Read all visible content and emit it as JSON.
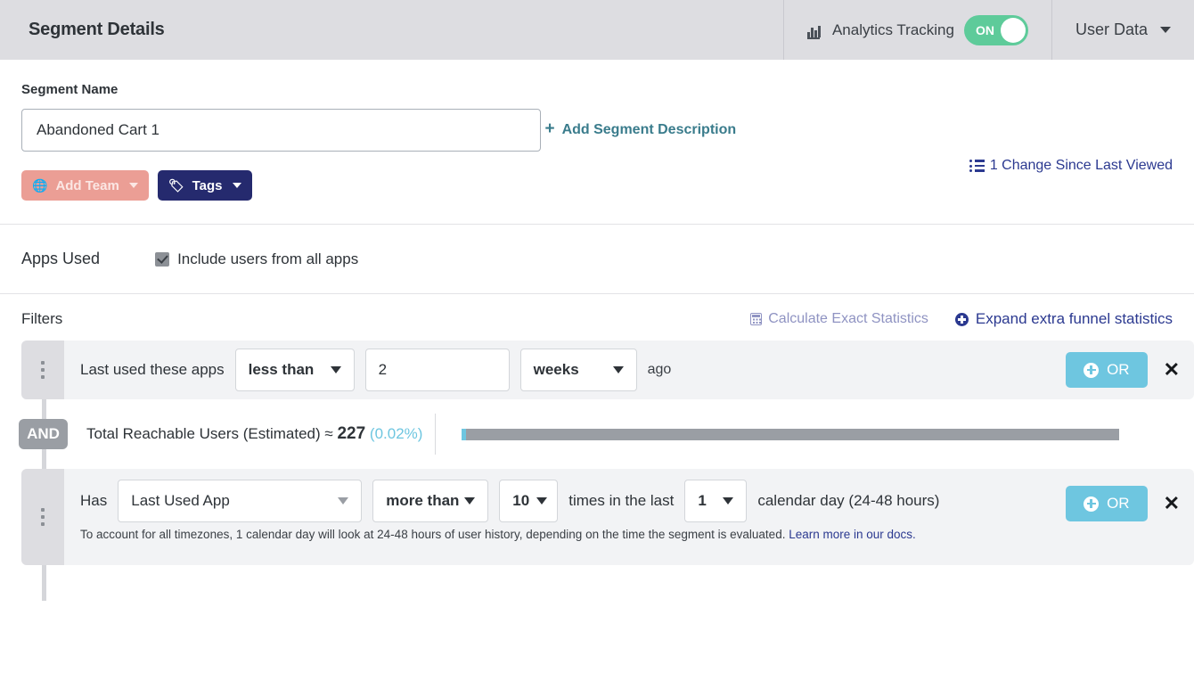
{
  "header": {
    "title": "Segment Details",
    "analytics": {
      "label": "Analytics Tracking",
      "icon": "bar-chart-icon",
      "toggle_state": "ON",
      "toggle_color": "#5ecb9a"
    },
    "user_menu": {
      "label": "User Data",
      "icon": "chevron-down-icon"
    }
  },
  "segment": {
    "name_label": "Segment Name",
    "name_value": "Abandoned Cart 1",
    "name_placeholder": "Segment Name",
    "changes_link": "1 Change Since Last Viewed",
    "changes_icon": "list-icon",
    "add_description": "Add Segment Description",
    "add_description_icon": "plus-icon",
    "buttons": [
      {
        "label": "Add Team",
        "icon": "globe-icon",
        "color": "#eb9e95",
        "text_color": "#fbe7e4",
        "disabled": true
      },
      {
        "label": "Tags",
        "icon": "tag-icon",
        "color": "#252a6e",
        "text_color": "#ffffff",
        "disabled": false
      }
    ]
  },
  "apps_used": {
    "label": "Apps Used",
    "checkbox_label": "Include users from all apps",
    "checked": true
  },
  "filters": {
    "title": "Filters",
    "calculate_link": "Calculate Exact Statistics",
    "calculate_icon": "calculator-icon",
    "expand_link": "Expand extra funnel statistics",
    "expand_icon": "plus-circle-icon",
    "rows": [
      {
        "prefix": "Last used these apps",
        "operator": "less than",
        "amount": "2",
        "unit": "weeks",
        "suffix": "ago",
        "or_label": "OR",
        "close_icon": "close-icon"
      },
      {
        "prefix": "Has",
        "property": "Last Used App",
        "operator": "more than",
        "count": "10",
        "mid_text": "times in the last",
        "period": "1",
        "suffix": "calendar day (24-48 hours)",
        "help_text": "To account for all timezones, 1 calendar day will look at 24-48 hours of user history, depending on the time the segment is evaluated.",
        "help_link": "Learn more in our docs.",
        "or_label": "OR",
        "close_icon": "close-icon"
      }
    ],
    "connector": "AND",
    "stats": {
      "label": "Total Reachable Users (Estimated)",
      "approx": "≈",
      "value": "227",
      "percent": "(0.02%)",
      "bar_fill_percent": 0.6,
      "bar_color": "#6ec6e0",
      "track_color": "#9a9ea4"
    }
  }
}
